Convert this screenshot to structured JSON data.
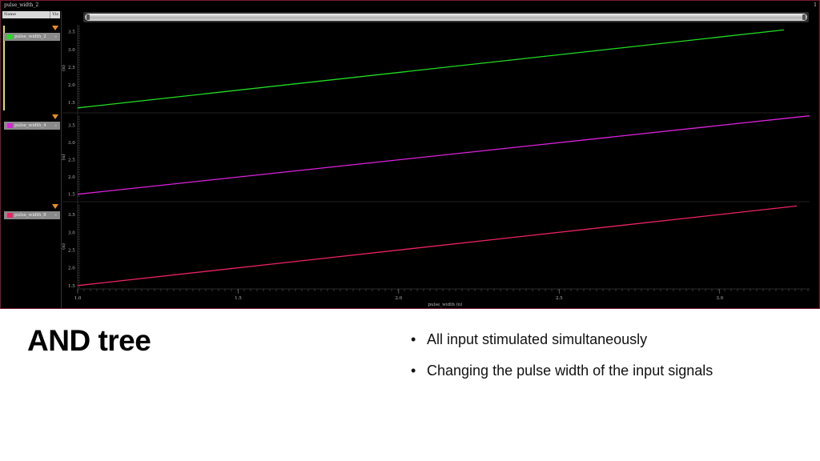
{
  "window": {
    "title": "pulse_width_2",
    "corner_number": "1"
  },
  "signal_list": {
    "header_name": "Name",
    "header_vis": "Vis",
    "signals": [
      {
        "name": "pulse_width_2",
        "color": "#22dd22",
        "vis": "»"
      },
      {
        "name": "pulse_width_4",
        "color": "#dd22dd",
        "vis": "»"
      },
      {
        "name": "pulse_width_8",
        "color": "#ee2266",
        "vis": "»"
      }
    ]
  },
  "chart_data": {
    "type": "line",
    "xlabel": "pulse_width (n)",
    "xlim": [
      1.0,
      3.28
    ],
    "x_ticks": [
      "1.0",
      "1.5",
      "2.0",
      "2.5",
      "3.0"
    ],
    "panels": [
      {
        "series_name": "pulse_width_2",
        "color": "#22dd22",
        "ylabel": "(n)",
        "ylim": [
          1.3,
          3.65
        ],
        "y_ticks": [
          "1.5",
          "2.0",
          "2.5",
          "3.0",
          "3.5"
        ],
        "x": [
          1.0,
          3.2
        ],
        "y": [
          1.35,
          3.55
        ]
      },
      {
        "series_name": "pulse_width_4",
        "color": "#dd22dd",
        "ylabel": "(n)",
        "ylim": [
          1.4,
          3.75
        ],
        "y_ticks": [
          "1.5",
          "2.0",
          "2.5",
          "3.0",
          "3.5"
        ],
        "x": [
          1.0,
          3.28
        ],
        "y": [
          1.5,
          3.78
        ]
      },
      {
        "series_name": "pulse_width_8",
        "color": "#ee2266",
        "ylabel": "(n)",
        "ylim": [
          1.45,
          3.75
        ],
        "y_ticks": [
          "1.5",
          "2.0",
          "2.5",
          "3.0",
          "3.5"
        ],
        "x": [
          1.0,
          3.24
        ],
        "y": [
          1.5,
          3.74
        ]
      }
    ]
  },
  "slide": {
    "title": "AND tree",
    "bullets": [
      "All input stimulated simultaneously",
      "Changing the pulse width of the input signals"
    ],
    "bullet_glyph": "•"
  }
}
